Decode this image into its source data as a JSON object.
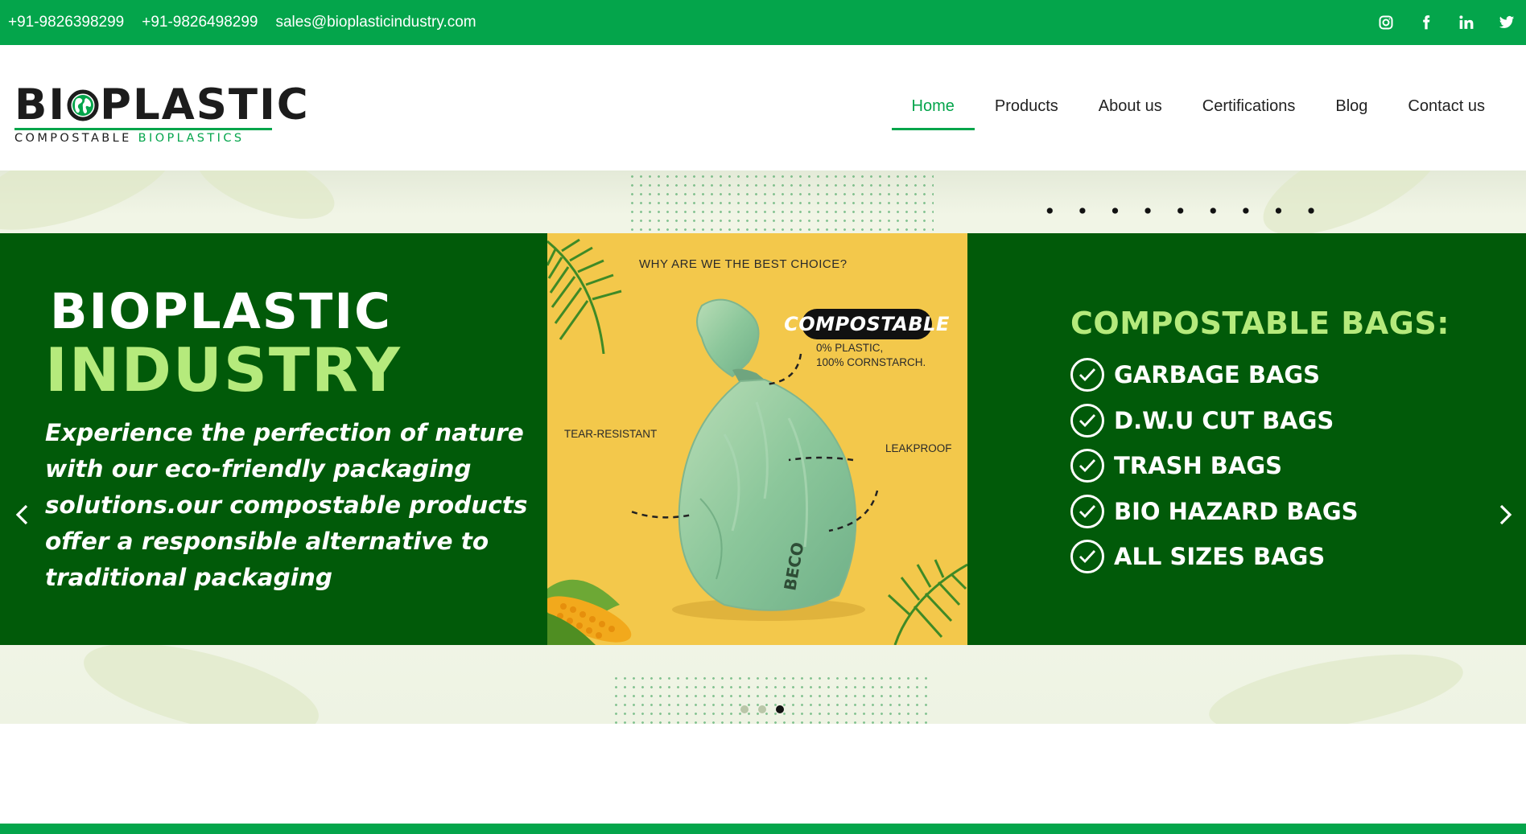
{
  "topbar": {
    "phone1": "+91-9826398299",
    "phone2": "+91-9826498299",
    "email": "sales@bioplasticindustry.com",
    "socials": [
      "instagram-icon",
      "facebook-icon",
      "linkedin-icon",
      "twitter-icon"
    ]
  },
  "logo": {
    "word_start": "BI",
    "word_end": "PLASTIC",
    "tag_start": "COMPOSTABLE",
    "tag_end": "BIOPLASTICS"
  },
  "nav": {
    "items": [
      "Home",
      "Products",
      "About us",
      "Certifications",
      "Blog",
      "Contact us"
    ],
    "active": "Home"
  },
  "hero": {
    "title_line1": "BIOPLASTIC",
    "title_line2": "INDUSTRY",
    "description": "Experience the perfection of nature with our eco-friendly packaging solutions.our compostable products offer a responsible alternative to traditional packaging",
    "panel": {
      "question": "WHY ARE WE THE BEST CHOICE?",
      "badge": "COMPOSTABLE",
      "detail_line1": "0% PLASTIC,",
      "detail_line2": "100% CORNSTARCH.",
      "tear": "TEAR-RESISTANT",
      "leak": "LEAKPROOF",
      "bag_brand": "BECO"
    },
    "list_heading": "COMPOSTABLE BAGS:",
    "list": [
      "GARBAGE BAGS",
      "D.W.U CUT BAGS",
      "TRASH BAGS",
      "BIO HAZARD BAGS",
      "ALL SIZES BAGS"
    ],
    "slide_count": 3,
    "active_slide": 3
  },
  "colors": {
    "brand_green": "#04a54b",
    "slide_green": "#015a09",
    "accent_lime": "#b5ea7c",
    "panel_yellow": "#f3c84b"
  }
}
